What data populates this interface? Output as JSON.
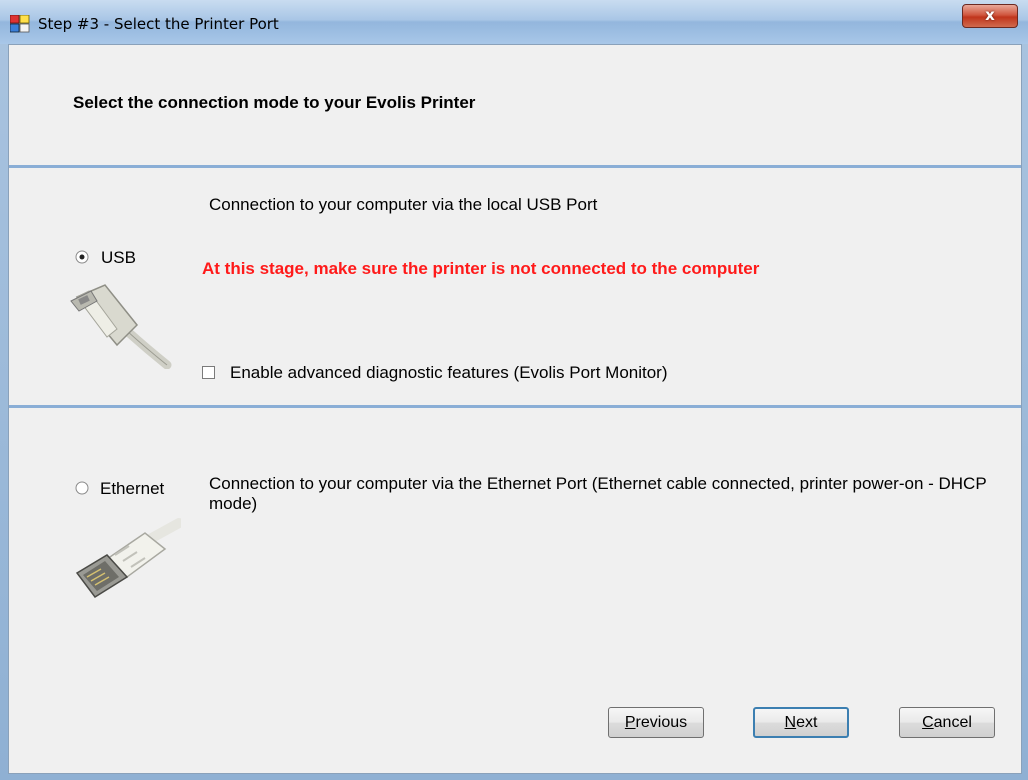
{
  "window": {
    "title": "Step #3 - Select the Printer Port",
    "close_label": "x"
  },
  "header": {
    "instruction": "Select the connection mode to your Evolis Printer"
  },
  "usb": {
    "radio_label": "USB",
    "selected": true,
    "description": "Connection to your computer via the local USB Port",
    "warning": "At this stage, make sure the printer is not connected to the computer",
    "warning_color": "#ff1a1a",
    "icon": "usb-cable-icon",
    "advanced_checkbox_label": "Enable advanced diagnostic features (Evolis Port Monitor)",
    "advanced_checked": false
  },
  "ethernet": {
    "radio_label": "Ethernet",
    "selected": false,
    "description": "Connection to your computer via the Ethernet Port (Ethernet cable connected, printer power-on  - DHCP mode)",
    "icon": "ethernet-cable-icon"
  },
  "buttons": {
    "previous_mnemonic": "P",
    "previous_rest": "revious",
    "next_mnemonic": "N",
    "next_rest": "ext",
    "cancel_mnemonic": "C",
    "cancel_rest": "ancel"
  }
}
